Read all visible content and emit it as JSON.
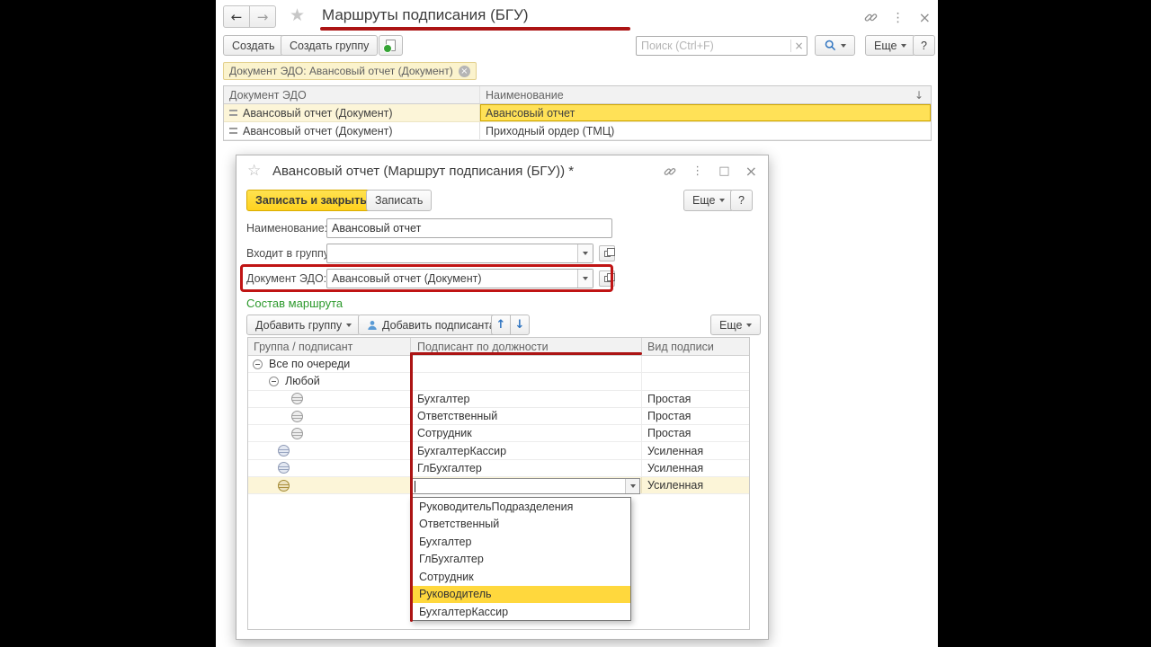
{
  "icons": {
    "back": "←",
    "forward": "→",
    "star": "★",
    "star_outline": "☆",
    "kebab": "⋮",
    "close": "×",
    "maximize": "□",
    "sort": "↓",
    "up": "↑",
    "down": "↓",
    "clear": "×",
    "tag_close": "×",
    "caret_bar": ""
  },
  "window": {
    "title": "Маршруты подписания (БГУ)",
    "toolbar": {
      "create": "Создать",
      "create_group": "Создать группу",
      "search_placeholder": "Поиск (Ctrl+F)",
      "more": "Еще",
      "help": "?"
    },
    "filter_tag": "Документ ЭДО: Авансовый отчет (Документ)",
    "table": {
      "columns": [
        "Документ ЭДО",
        "Наименование"
      ],
      "rows": [
        {
          "document": "Авансовый отчет (Документ)",
          "name": "Авансовый отчет"
        },
        {
          "document": "Авансовый отчет (Документ)",
          "name": "Приходный ордер (ТМЦ)"
        }
      ]
    }
  },
  "dialog": {
    "title": "Авансовый отчет (Маршрут подписания (БГУ)) *",
    "buttons": {
      "save_and_close": "Записать и закрыть",
      "save": "Записать",
      "more": "Еще",
      "help": "?"
    },
    "fields": [
      {
        "label": "Наименование:",
        "value": "Авансовый отчет"
      },
      {
        "label": "Входит в группу:",
        "value": ""
      },
      {
        "label": "Документ ЭДО:",
        "value": "Авансовый отчет (Документ)"
      }
    ],
    "section_link": "Состав маршрута",
    "toolbar": {
      "add_group": "Добавить группу",
      "add_signer": "Добавить подписанта",
      "more": "Еще"
    },
    "table": {
      "columns": [
        "Группа / подписант",
        "Подписант по должности",
        "Вид подписи"
      ],
      "rows": [
        {
          "group": "Все по очереди",
          "signer": "",
          "type": ""
        },
        {
          "group": "Любой",
          "signer": "",
          "type": ""
        },
        {
          "group": "",
          "signer": "Бухгалтер",
          "type": "Простая"
        },
        {
          "group": "",
          "signer": "Ответственный",
          "type": "Простая"
        },
        {
          "group": "",
          "signer": "Сотрудник",
          "type": "Простая"
        },
        {
          "group": "",
          "signer": "БухгалтерКассир",
          "type": "Усиленная"
        },
        {
          "group": "",
          "signer": "ГлБухгалтер",
          "type": "Усиленная"
        },
        {
          "group": "",
          "signer": "",
          "type": "Усиленная"
        }
      ]
    },
    "dropdown": {
      "items": [
        "РуководительПодразделения",
        "Ответственный",
        "Бухгалтер",
        "ГлБухгалтер",
        "Сотрудник",
        "Руководитель",
        "БухгалтерКассир"
      ],
      "highlighted": "Руководитель"
    }
  },
  "colors": {
    "annotation_red": "#ac1414",
    "selection_yellow": "#fcf5d8",
    "active_cell_yellow": "#ffe157",
    "primary_button_yellow": "#ffd21e",
    "link_green": "#2d9a2d"
  }
}
